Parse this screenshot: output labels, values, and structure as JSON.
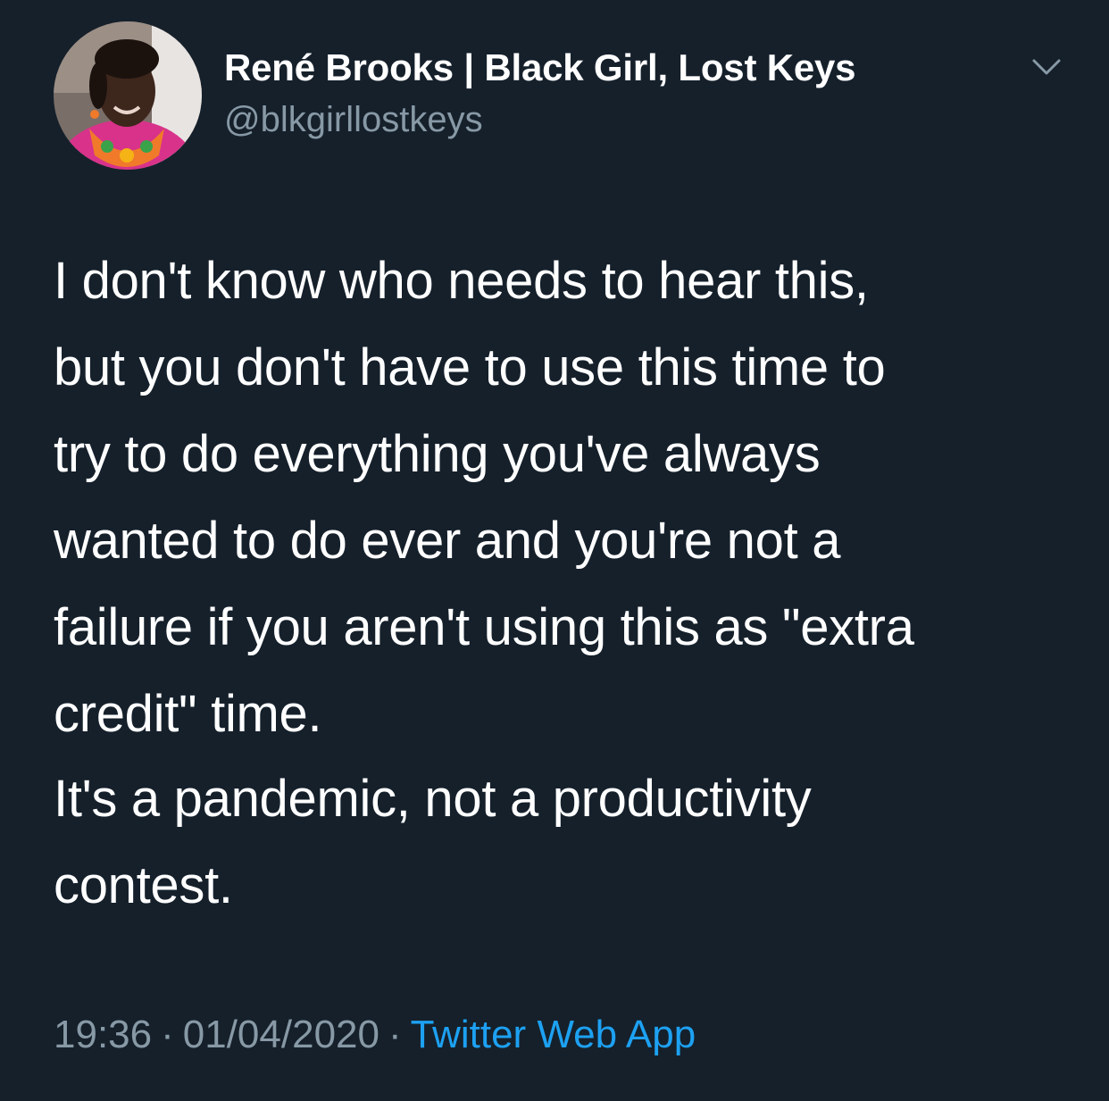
{
  "tweet": {
    "author": {
      "name": "René Brooks | Black Girl, Lost Keys",
      "handle": "@blkgirllostkeys"
    },
    "body": {
      "paragraph1_lines": [
        "I don't know who needs to hear this,",
        "but you don't have to use this time to",
        "try to do everything you've always",
        "wanted to do ever and you're not a",
        "failure if you aren't using this as \"extra",
        "credit\" time."
      ],
      "paragraph2_lines": [
        "It's a pandemic, not a productivity",
        "contest."
      ]
    },
    "meta": {
      "time": "19:36",
      "separator": "·",
      "date": "01/04/2020",
      "source": "Twitter Web App"
    }
  },
  "icons": {
    "menu": "chevron-down-icon"
  },
  "colors": {
    "background": "#15202b",
    "text": "#ffffff",
    "muted": "#8899a6",
    "link": "#1da1f2"
  }
}
